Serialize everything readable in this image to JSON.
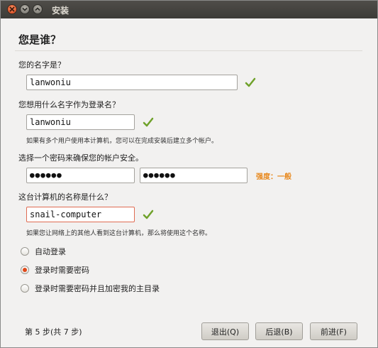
{
  "window": {
    "title": "安装"
  },
  "page": {
    "heading": "您是谁？"
  },
  "name": {
    "label": "您的名字是？",
    "value": "lanwoniu"
  },
  "login": {
    "label": "您想用什么名字作为登录名？",
    "value": "lanwoniu",
    "hint": "如果有多个用户使用本计算机，您可以在完成安装后建立多个帐户。"
  },
  "password": {
    "label": "选择一个密码来确保您的帐户安全。",
    "value": "●●●●●●",
    "confirm_value": "●●●●●●",
    "strength": "强度：一般"
  },
  "computer": {
    "label": "这台计算机的名称是什么？",
    "value": "snail-computer",
    "hint": "如果您让网络上的其他人看到这台计算机，那么将使用这个名称。"
  },
  "login_options": [
    {
      "label": "自动登录",
      "selected": false
    },
    {
      "label": "登录时需要密码",
      "selected": true
    },
    {
      "label": "登录时需要密码并且加密我的主目录",
      "selected": false
    }
  ],
  "footer": {
    "step": "第 5 步(共 7 步)",
    "quit_label": "退出(Q)",
    "back_label": "后退(B)",
    "forward_label": "前进(F)"
  },
  "colors": {
    "accent": "#e0491a",
    "check": "#6fa12a",
    "strength": "#e8891e",
    "error_border": "#e06b52"
  },
  "icons": {
    "valid": "check-icon",
    "close": "close-icon",
    "minimize": "minimize-icon",
    "maximize": "maximize-icon"
  }
}
